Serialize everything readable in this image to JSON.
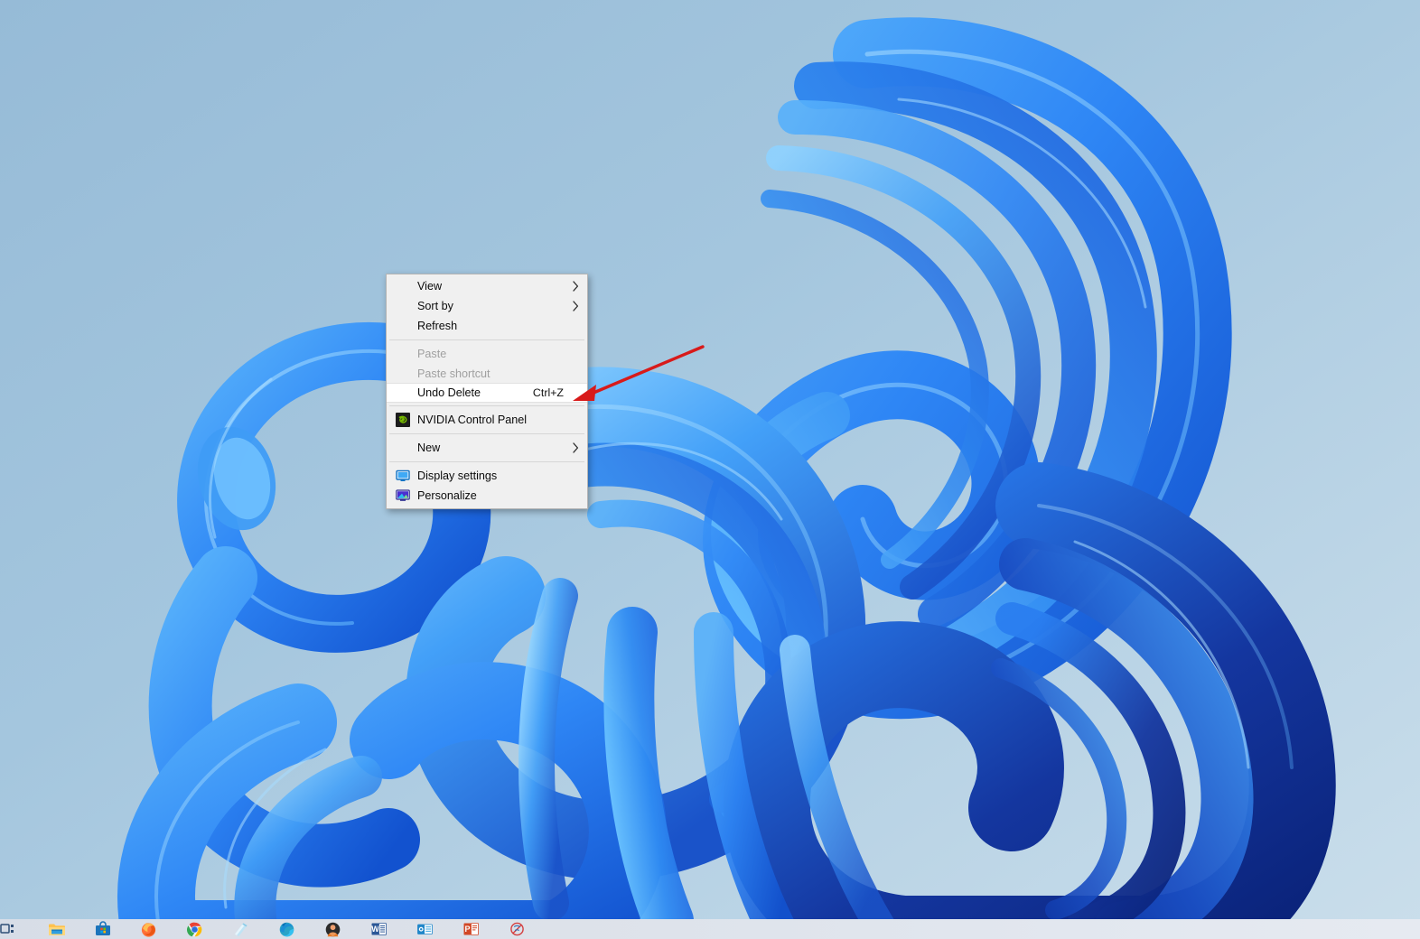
{
  "desktop": {
    "wallpaper_name": "windows-11-bloom-wallpaper",
    "background_color_top_left": "#9dc0da",
    "background_color_bottom_right": "#c6dcea",
    "bloom_color_light": "#4aa3f7",
    "bloom_color_mid": "#1f6fe0",
    "bloom_color_dark": "#0b2f9e"
  },
  "context_menu": {
    "name": "desktop-context-menu",
    "items": [
      {
        "label": "View",
        "type": "submenu",
        "state": "normal",
        "accel": "",
        "icon": ""
      },
      {
        "label": "Sort by",
        "type": "submenu",
        "state": "normal",
        "accel": "",
        "icon": ""
      },
      {
        "label": "Refresh",
        "type": "command",
        "state": "normal",
        "accel": "",
        "icon": ""
      },
      {
        "label": "",
        "type": "separator",
        "state": "normal",
        "accel": "",
        "icon": ""
      },
      {
        "label": "Paste",
        "type": "command",
        "state": "disabled",
        "accel": "",
        "icon": ""
      },
      {
        "label": "Paste shortcut",
        "type": "command",
        "state": "disabled",
        "accel": "",
        "icon": ""
      },
      {
        "label": "Undo Delete",
        "type": "command",
        "state": "highlight",
        "accel": "Ctrl+Z",
        "icon": ""
      },
      {
        "label": "",
        "type": "separator",
        "state": "normal",
        "accel": "",
        "icon": ""
      },
      {
        "label": "NVIDIA Control Panel",
        "type": "command",
        "state": "normal",
        "accel": "",
        "icon": "nvidia-icon"
      },
      {
        "label": "",
        "type": "separator",
        "state": "normal",
        "accel": "",
        "icon": ""
      },
      {
        "label": "New",
        "type": "submenu",
        "state": "normal",
        "accel": "",
        "icon": ""
      },
      {
        "label": "",
        "type": "separator",
        "state": "normal",
        "accel": "",
        "icon": ""
      },
      {
        "label": "Display settings",
        "type": "command",
        "state": "normal",
        "accel": "",
        "icon": "display-settings-icon"
      },
      {
        "label": "Personalize",
        "type": "command",
        "state": "normal",
        "accel": "",
        "icon": "personalize-icon"
      }
    ]
  },
  "annotation": {
    "name": "red-arrow-annotation",
    "color": "#d81a1a",
    "points_to": "Undo Delete"
  },
  "taskbar": {
    "name": "windows-taskbar",
    "background_color": "#dde3ea",
    "items": [
      {
        "label": "Task View",
        "icon": "task-view-icon"
      },
      {
        "label": "File Explorer",
        "icon": "file-explorer-icon"
      },
      {
        "label": "Microsoft Store",
        "icon": "microsoft-store-icon"
      },
      {
        "label": "Mozilla Firefox",
        "icon": "firefox-icon"
      },
      {
        "label": "Google Chrome",
        "icon": "chrome-icon"
      },
      {
        "label": "Notepad",
        "icon": "notepad-icon"
      },
      {
        "label": "Microsoft Edge",
        "icon": "edge-icon"
      },
      {
        "label": "Skype",
        "icon": "skype-icon"
      },
      {
        "label": "Microsoft Word",
        "icon": "word-icon"
      },
      {
        "label": "Microsoft Outlook",
        "icon": "outlook-icon"
      },
      {
        "label": "Microsoft PowerPoint",
        "icon": "powerpoint-icon"
      },
      {
        "label": "Snipping Tool",
        "icon": "snipping-tool-icon"
      }
    ]
  }
}
